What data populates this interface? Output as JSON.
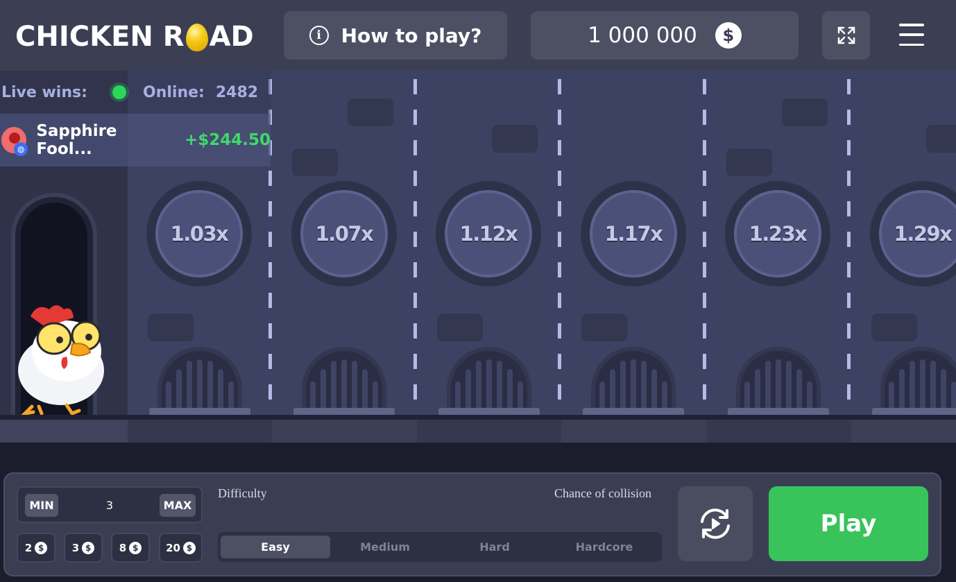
{
  "header": {
    "logo_left": "CHICKEN R",
    "logo_right": "AD",
    "howto_label": "How to play?",
    "balance": "1 000 000",
    "currency_symbol": "$"
  },
  "live": {
    "live_wins_label": "Live wins:",
    "online_label": "Online:",
    "online_count": "2482",
    "latest_win": {
      "player": "Sapphire Fool...",
      "amount": "+$244.50"
    }
  },
  "lanes": {
    "multipliers": [
      "1.03x",
      "1.07x",
      "1.12x",
      "1.17x",
      "1.23x",
      "1.29x"
    ]
  },
  "controls": {
    "bet": {
      "min_label": "MIN",
      "max_label": "MAX",
      "value": "3"
    },
    "quick_bets": [
      "2",
      "3",
      "8",
      "20"
    ],
    "difficulty_label": "Difficulty",
    "collision_label": "Chance of collision",
    "difficulties": [
      "Easy",
      "Medium",
      "Hard",
      "Hardcore"
    ],
    "selected_difficulty": "Easy",
    "play_label": "Play"
  },
  "colors": {
    "play_green": "#38c35b",
    "online_dot": "#2bd65b",
    "win_amount": "#3fd96a",
    "egg_gold": "#f6c915"
  }
}
